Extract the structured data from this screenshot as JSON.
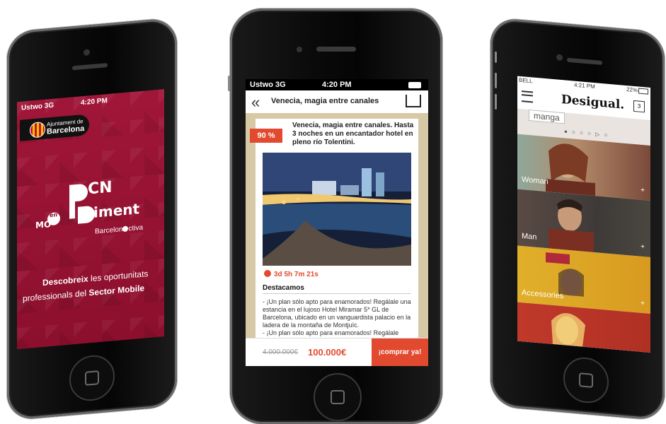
{
  "left": {
    "status": {
      "carrier": "Ustwo 3G",
      "time": "4:20 PM"
    },
    "ajuntament": {
      "line1": "Ajuntament de",
      "line2": "Barcelona"
    },
    "logo": {
      "part1": "CN",
      "part2": "iment",
      "sub": "Barcelon",
      "sub2": "ctiva",
      "en": "en",
      "mo": "MO"
    },
    "tagline1_bold": "Descobreix",
    "tagline1_rest": " les oportunitats",
    "tagline2_rest": "professionals del ",
    "tagline2_bold": "Sector Mobile"
  },
  "center": {
    "status": {
      "carrier": "Ustwo 3G",
      "time": "4:20 PM"
    },
    "nav_title": "Venecia, magia entre canales",
    "back_icon": "«",
    "badge": "90 %",
    "description": "Venecia, magia entre canales. Hasta 3 noches en un encantador hotel en pleno río Tolentini.",
    "timer": "3d 5h 7m 21s",
    "section": "Destacamos",
    "text": "- ¡Un plan sólo apto para enamorados! Regálale una estancia en el lujoso Hotel Miramar 5* GL de Barcelona, ubicado en un vanguardista palacio en la ladera de la montaña de Montjuïc.",
    "text2": "- ¡Un plan sólo apto para enamorados! Regálale",
    "old_price": "4.000.000€",
    "new_price": "100.000€",
    "buy": "¡comprar ya!"
  },
  "right": {
    "status": {
      "carrier": "BELL",
      "time": "4:21 PM",
      "battery": "22%"
    },
    "brand": "Desigual.",
    "bag_count": "3",
    "banner": "manga",
    "dots": "● ○ ○ ○ ▷ ○",
    "tiles": [
      {
        "label": "Woman",
        "plus": "+"
      },
      {
        "label": "Man",
        "plus": "+"
      },
      {
        "label": "Accessories",
        "plus": "+"
      },
      {
        "label": "",
        "plus": ""
      }
    ]
  }
}
